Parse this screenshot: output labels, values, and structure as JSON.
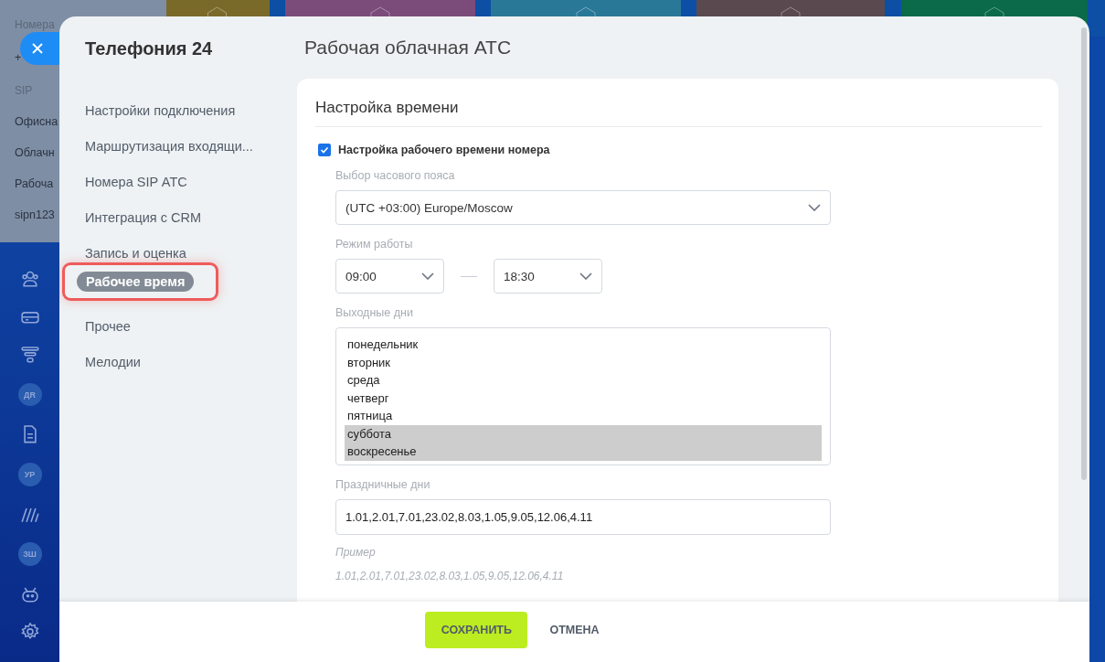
{
  "back_panel": {
    "heading": "Номера",
    "number": "+",
    "section": "SIP",
    "items": [
      "Офисна",
      "Облачн",
      "Рабоча",
      "sipn123"
    ]
  },
  "left_bar": [
    {
      "kind": "icon"
    },
    {
      "kind": "icon"
    },
    {
      "kind": "icon"
    },
    {
      "kind": "avatar",
      "text": "ДR"
    },
    {
      "kind": "icon"
    },
    {
      "kind": "avatar",
      "text": "УР"
    },
    {
      "kind": "icon"
    },
    {
      "kind": "avatar",
      "text": "ЗШ"
    },
    {
      "kind": "icon"
    },
    {
      "kind": "icon"
    }
  ],
  "modal": {
    "app_title": "Телефония 24",
    "page_title": "Рабочая облачная АТС",
    "nav": [
      {
        "label": "Настройки подключения",
        "selected": false
      },
      {
        "label": "Маршрутизация входящи...",
        "selected": false
      },
      {
        "label": "Номера SIP АТС",
        "selected": false
      },
      {
        "label": "Интеграция с CRM",
        "selected": false
      },
      {
        "label": "Запись и оценка",
        "selected": false
      },
      {
        "label": "Рабочее время",
        "selected": true
      },
      {
        "label": "Прочее",
        "selected": false
      },
      {
        "label": "Мелодии",
        "selected": false
      }
    ],
    "section": {
      "title": "Настройка времени",
      "checkbox": {
        "label": "Настройка рабочего времени номера",
        "checked": true
      },
      "timezone": {
        "label": "Выбор часового пояса",
        "value": "(UTC +03:00) Europe/Moscow"
      },
      "hours": {
        "label": "Режим работы",
        "from": "09:00",
        "to": "18:30"
      },
      "days_off": {
        "label": "Выходные дни",
        "options": [
          {
            "label": "понедельник",
            "selected": false
          },
          {
            "label": "вторник",
            "selected": false
          },
          {
            "label": "среда",
            "selected": false
          },
          {
            "label": "четверг",
            "selected": false
          },
          {
            "label": "пятница",
            "selected": false
          },
          {
            "label": "суббота",
            "selected": true
          },
          {
            "label": "воскресенье",
            "selected": true
          }
        ]
      },
      "holidays": {
        "label": "Праздничные дни",
        "value": "1.01,2.01,7.01,23.02,8.03,1.05,9.05,12.06,4.11",
        "hint_title": "Пример",
        "hint": "1.01,2.01,7.01,23.02,8.03,1.05,9.05,12.06,4.11"
      }
    },
    "buttons": {
      "save": "СОХРАНИТЬ",
      "cancel": "ОТМЕНА"
    }
  }
}
